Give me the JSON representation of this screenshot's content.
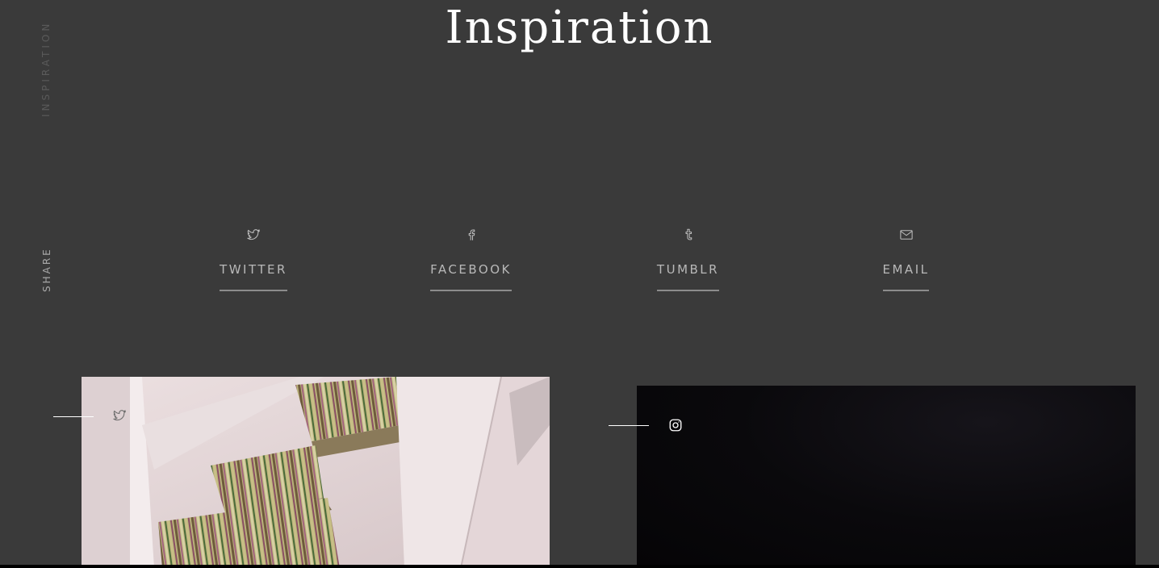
{
  "side": {
    "section_label": "INSPIRATION",
    "share_label": "SHARE"
  },
  "title": "Inspiration",
  "share": [
    {
      "icon": "twitter-icon",
      "label": "TWITTER"
    },
    {
      "icon": "facebook-icon",
      "label": "FACEBOOK"
    },
    {
      "icon": "tumblr-icon",
      "label": "TUMBLR"
    },
    {
      "icon": "envelope-icon",
      "label": "EMAIL"
    }
  ],
  "posts": [
    {
      "source_icon": "twitter-icon",
      "image": "striped-stair-carpet"
    },
    {
      "source_icon": "instagram-icon",
      "image": "dark-photo"
    }
  ],
  "colors": {
    "background": "#3a3a3a",
    "title": "#ffffff",
    "share_text": "#b8b8b8",
    "share_underline": "#8c8c8c"
  }
}
